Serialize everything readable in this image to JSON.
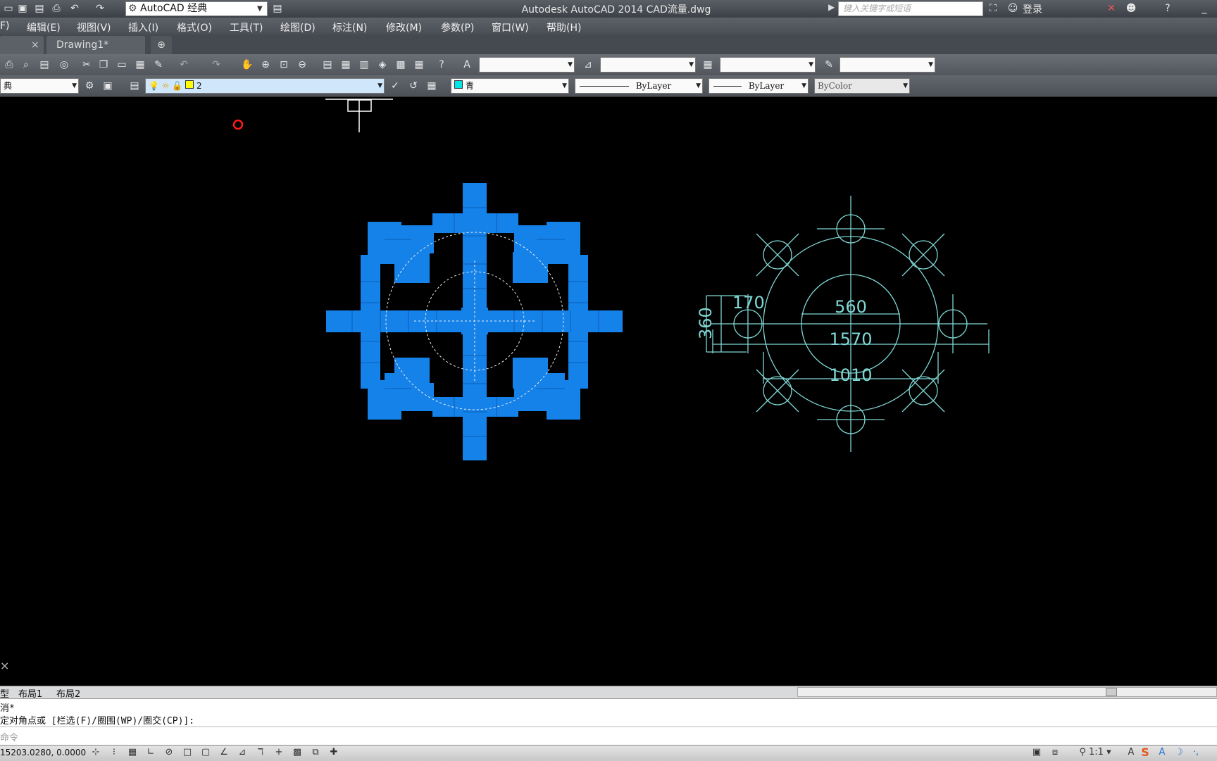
{
  "titlebar": {
    "workspace": "AutoCAD 经典",
    "title": "Autodesk AutoCAD 2014    CAD流量.dwg",
    "search_placeholder": "键入关键字或短语",
    "login": "登录"
  },
  "menu": {
    "items": [
      "F)",
      "编辑(E)",
      "视图(V)",
      "插入(I)",
      "格式(O)",
      "工具(T)",
      "绘图(D)",
      "标注(N)",
      "修改(M)",
      "参数(P)",
      "窗口(W)",
      "帮助(H)"
    ]
  },
  "tabs": {
    "drawing1": "Drawing1*"
  },
  "toolbar2": {
    "workspace_short": "典",
    "layer": "2",
    "color": "青",
    "linetype": "ByLayer",
    "lineweight": "ByLayer",
    "plotstyle": "ByColor"
  },
  "dimensions": {
    "d170": "170",
    "d360": "360",
    "d560": "560",
    "d1570": "1570",
    "d1010": "1010"
  },
  "layout_tabs": [
    "型",
    "布局1",
    "布局2"
  ],
  "command": {
    "line1": "消*",
    "line2": "定对角点或 [栏选(F)/圈围(WP)/圈交(CP)]:",
    "prompt": "命令"
  },
  "status": {
    "coords": "15203.0280,  0.0000",
    "scale": "1:1"
  },
  "colors": {
    "hatch": "#1582ea",
    "cyan": "#7fd7d4",
    "background": "#000000"
  }
}
